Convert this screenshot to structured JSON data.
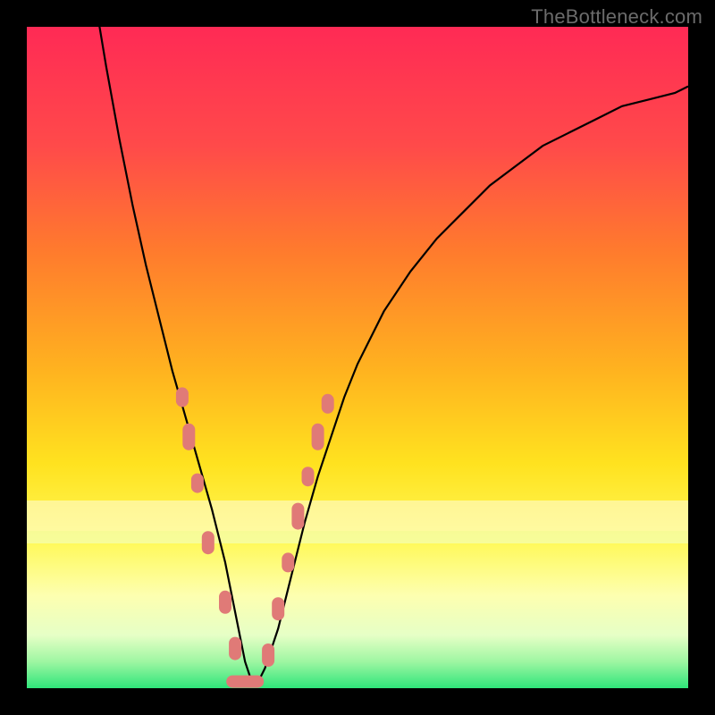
{
  "watermark": "TheBottleneck.com",
  "colors": {
    "background": "#000000",
    "marker": "#e07a77",
    "curve": "#000000",
    "gradient_top": "#ff2a55",
    "gradient_mid_upper": "#ff7b2d",
    "gradient_mid": "#ffd21f",
    "gradient_mid_lower": "#fff95a",
    "gradient_lower_band": "#f8ffe0",
    "gradient_bottom": "#2fe57a"
  },
  "chart_data": {
    "type": "line",
    "title": "",
    "xlabel": "",
    "ylabel": "",
    "xlim": [
      0,
      100
    ],
    "ylim": [
      0,
      100
    ],
    "series": [
      {
        "name": "bottleneck-curve",
        "x": [
          8,
          10,
          12,
          14,
          16,
          18,
          20,
          22,
          24,
          26,
          28,
          30,
          31,
          32,
          33,
          34,
          35,
          36,
          38,
          40,
          42,
          44,
          46,
          48,
          50,
          54,
          58,
          62,
          66,
          70,
          74,
          78,
          82,
          86,
          90,
          94,
          98,
          100
        ],
        "y": [
          118,
          106,
          94,
          83,
          73,
          64,
          56,
          48,
          41,
          34,
          27,
          19,
          14,
          9,
          4,
          1,
          1,
          3,
          9,
          17,
          25,
          32,
          38,
          44,
          49,
          57,
          63,
          68,
          72,
          76,
          79,
          82,
          84,
          86,
          88,
          89,
          90,
          91
        ]
      }
    ],
    "markers": [
      {
        "x": 23.5,
        "y": 44,
        "len": 3
      },
      {
        "x": 24.5,
        "y": 38,
        "len": 5
      },
      {
        "x": 25.8,
        "y": 31,
        "len": 3
      },
      {
        "x": 27.4,
        "y": 22,
        "len": 4
      },
      {
        "x": 30.0,
        "y": 13,
        "len": 4
      },
      {
        "x": 31.5,
        "y": 6,
        "len": 4
      },
      {
        "x": 33.0,
        "y": 1,
        "len": 6,
        "horizontal": true
      },
      {
        "x": 36.5,
        "y": 5,
        "len": 4
      },
      {
        "x": 38.0,
        "y": 12,
        "len": 4
      },
      {
        "x": 39.5,
        "y": 19,
        "len": 3
      },
      {
        "x": 41.0,
        "y": 26,
        "len": 5
      },
      {
        "x": 42.5,
        "y": 32,
        "len": 3
      },
      {
        "x": 44.0,
        "y": 38,
        "len": 5
      },
      {
        "x": 45.5,
        "y": 43,
        "len": 3
      }
    ],
    "bands": [
      {
        "y": 28,
        "color": "#f4fecb",
        "height": 2
      },
      {
        "y": 26,
        "color": "#e3fdb1",
        "height": 2
      },
      {
        "y": 22,
        "color": "#fffef0",
        "height": 4
      },
      {
        "y": 20,
        "color": "#f6ffd0",
        "height": 2
      }
    ],
    "annotation": ""
  }
}
